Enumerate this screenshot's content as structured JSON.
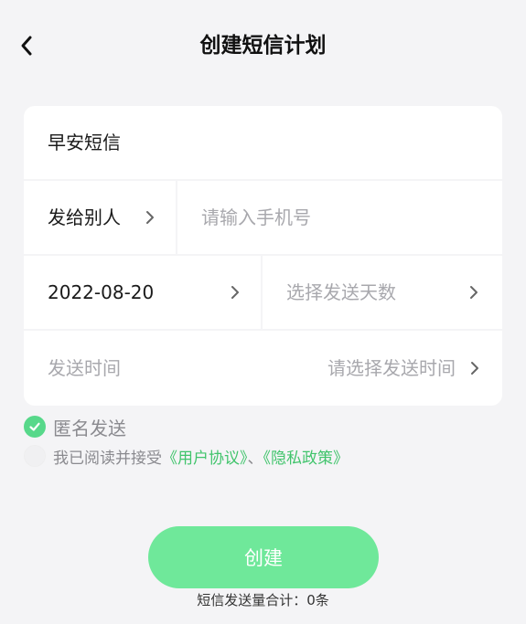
{
  "header": {
    "title": "创建短信计划"
  },
  "form": {
    "plan_name": "早安短信",
    "recipient_type": "发给别人",
    "phone_placeholder": "请输入手机号",
    "start_date": "2022-08-20",
    "days_placeholder": "选择发送天数",
    "send_time_label": "发送时间",
    "send_time_placeholder": "请选择发送时间"
  },
  "options": {
    "anonymous_label": "匿名发送",
    "anonymous_checked": true,
    "agreement_prefix": "我已阅读并接受",
    "user_agreement": "《用户协议》",
    "separator": "、",
    "privacy_policy": "《隐私政策》",
    "agreement_checked": false
  },
  "actions": {
    "create_label": "创建"
  },
  "footer": {
    "total_label": "短信发送量合计：0条"
  },
  "colors": {
    "accent": "#57d88a",
    "link": "#41c46c",
    "button": "#6fe89a",
    "background": "#f4f4f6"
  },
  "icons": {
    "back": "chevron-left-icon",
    "row_arrow": "chevron-right-icon",
    "check": "checkmark-icon"
  }
}
